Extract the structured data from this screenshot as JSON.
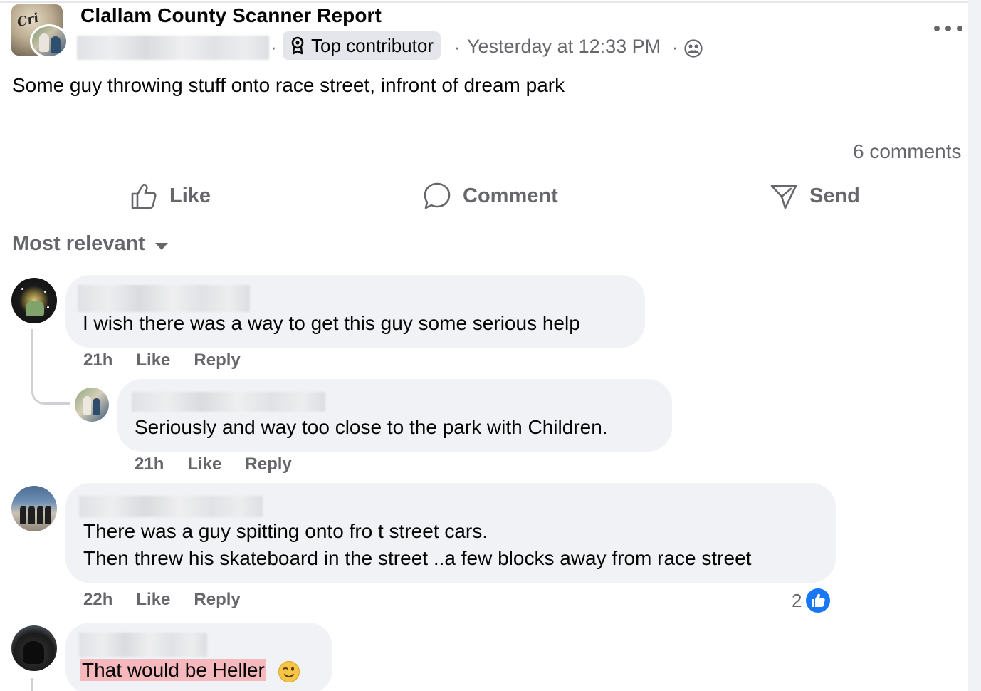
{
  "post": {
    "group_name": "Clallam County Scanner Report",
    "badge_label": "Top contributor",
    "timestamp": "Yesterday at 12:33 PM",
    "separator": "·",
    "text": "Some guy throwing stuff onto race street, infront of dream park",
    "comment_count": "6 comments"
  },
  "actions": {
    "like": "Like",
    "comment": "Comment",
    "send": "Send"
  },
  "sort": {
    "label": "Most relevant"
  },
  "comments": [
    {
      "text": "I wish there was a way to get this guy some serious help",
      "time": "21h",
      "like": "Like",
      "reply": "Reply"
    },
    {
      "text": "Seriously and way too close to the park with Children.",
      "time": "21h",
      "like": "Like",
      "reply": "Reply"
    },
    {
      "text_line1": "There was a guy spitting onto fro t street cars.",
      "text_line2": "Then threw his skateboard in the street ..a few blocks away from race street",
      "time": "22h",
      "like": "Like",
      "reply": "Reply",
      "reaction_count": "2"
    },
    {
      "text": "That would be Heller"
    }
  ],
  "colors": {
    "accent": "#1877f2",
    "secondary_text": "#65676b",
    "bubble": "#f0f2f5",
    "highlight": "#f4b8bd"
  }
}
